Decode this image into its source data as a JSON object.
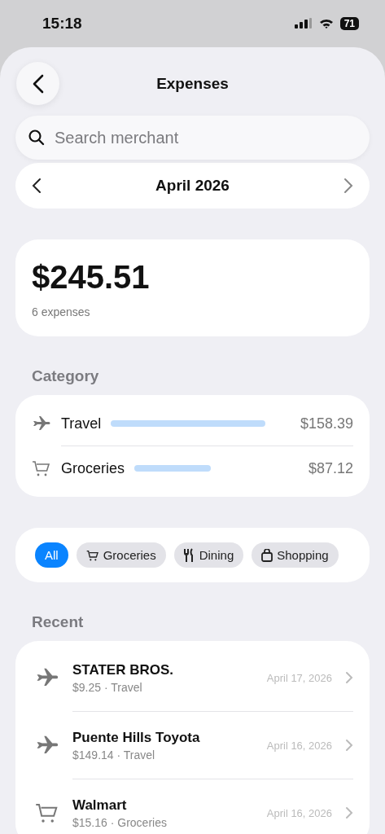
{
  "status_bar": {
    "time": "15:18",
    "battery": "71"
  },
  "header": {
    "title": "Expenses"
  },
  "search": {
    "placeholder": "Search merchant"
  },
  "month": {
    "label": "April 2026"
  },
  "summary": {
    "total": "$245.51",
    "count": "6 expenses"
  },
  "category_section": {
    "title": "Category"
  },
  "categories": [
    {
      "kind": "plane",
      "name": "Travel",
      "amount": "$158.39"
    },
    {
      "kind": "cart",
      "name": "Groceries",
      "amount": "$87.12"
    }
  ],
  "filters": [
    {
      "kind": "none",
      "label": "All",
      "selected": true
    },
    {
      "kind": "cart",
      "label": "Groceries",
      "selected": false
    },
    {
      "kind": "fork",
      "label": "Dining",
      "selected": false
    },
    {
      "kind": "bag",
      "label": "Shopping",
      "selected": false
    }
  ],
  "recent_section": {
    "title": "Recent"
  },
  "expenses": [
    {
      "kind": "plane",
      "merchant": "STATER BROS.",
      "detail": "$9.25 · Travel",
      "date": "April 17, 2026"
    },
    {
      "kind": "plane",
      "merchant": "Puente Hills Toyota",
      "detail": "$149.14 · Travel",
      "date": "April 16, 2026"
    },
    {
      "kind": "cart",
      "merchant": "Walmart",
      "detail": "$15.16 · Groceries",
      "date": "April 16, 2026"
    }
  ]
}
